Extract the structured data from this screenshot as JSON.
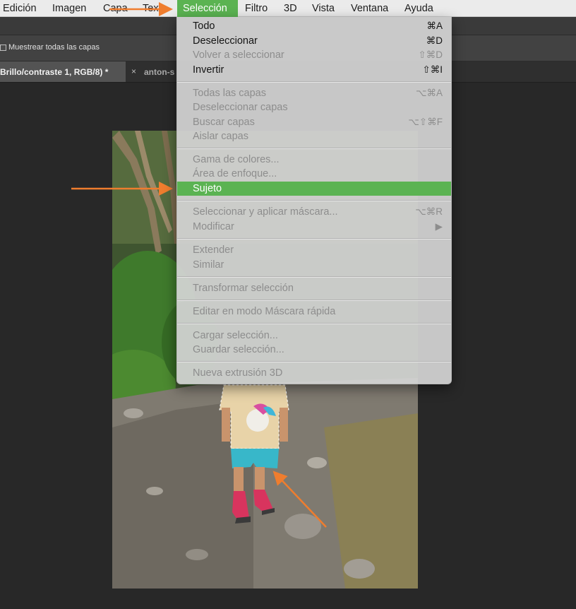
{
  "menubar": {
    "items": [
      "Edición",
      "Imagen",
      "Capa",
      "Texto",
      "Selección",
      "Filtro",
      "3D",
      "Vista",
      "Ventana",
      "Ayuda"
    ],
    "active_index": 4
  },
  "options_bar": {
    "sample_all_layers_label": "Muestrear todas las capas",
    "sample_all_layers_checked": false
  },
  "tabs": {
    "active_title": "Brillo/contraste 1, RGB/8) *",
    "second_title": "anton-s",
    "close_symbol": "×"
  },
  "selection_menu": {
    "groups": [
      [
        {
          "label": "Todo",
          "shortcut": "⌘A",
          "enabled": true
        },
        {
          "label": "Deseleccionar",
          "shortcut": "⌘D",
          "enabled": true
        },
        {
          "label": "Volver a seleccionar",
          "shortcut": "⇧⌘D",
          "enabled": false
        },
        {
          "label": "Invertir",
          "shortcut": "⇧⌘I",
          "enabled": true
        }
      ],
      [
        {
          "label": "Todas las capas",
          "shortcut": "⌥⌘A",
          "enabled": false
        },
        {
          "label": "Deseleccionar capas",
          "shortcut": "",
          "enabled": false
        },
        {
          "label": "Buscar capas",
          "shortcut": "⌥⇧⌘F",
          "enabled": false
        },
        {
          "label": "Aislar capas",
          "shortcut": "",
          "enabled": false
        }
      ],
      [
        {
          "label": "Gama de colores...",
          "shortcut": "",
          "enabled": false
        },
        {
          "label": "Área de enfoque...",
          "shortcut": "",
          "enabled": false
        },
        {
          "label": "Sujeto",
          "shortcut": "",
          "enabled": true,
          "highlighted": true
        }
      ],
      [
        {
          "label": "Seleccionar y aplicar máscara...",
          "shortcut": "⌥⌘R",
          "enabled": false
        },
        {
          "label": "Modificar",
          "shortcut": "▶",
          "enabled": false
        }
      ],
      [
        {
          "label": "Extender",
          "shortcut": "",
          "enabled": false
        },
        {
          "label": "Similar",
          "shortcut": "",
          "enabled": false
        }
      ],
      [
        {
          "label": "Transformar selección",
          "shortcut": "",
          "enabled": false
        }
      ],
      [
        {
          "label": "Editar en modo Máscara rápida",
          "shortcut": "",
          "enabled": false
        }
      ],
      [
        {
          "label": "Cargar selección...",
          "shortcut": "",
          "enabled": false
        },
        {
          "label": "Guardar selección...",
          "shortcut": "",
          "enabled": false
        }
      ],
      [
        {
          "label": "Nueva extrusión 3D",
          "shortcut": "",
          "enabled": false
        }
      ]
    ]
  },
  "colors": {
    "accent_green": "#5bb352",
    "annotation_arrow": "#ef7d2e"
  }
}
